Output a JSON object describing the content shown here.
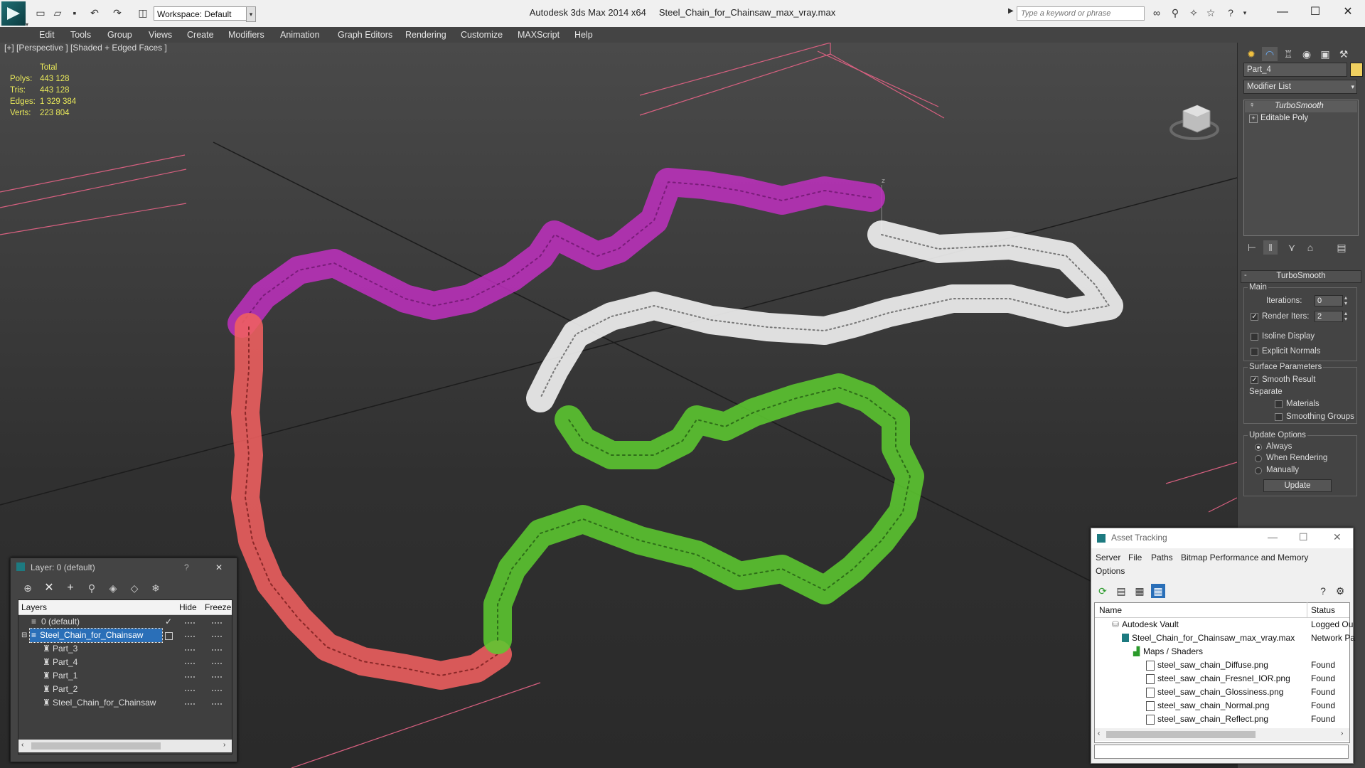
{
  "window": {
    "app_title": "Autodesk 3ds Max  2014 x64",
    "file_title": "Steel_Chain_for_Chainsaw_max_vray.max",
    "workspace_label": "Workspace: Default",
    "search_placeholder": "Type a keyword or phrase",
    "minimize": "—",
    "maximize": "☐",
    "close": "✕"
  },
  "menu": [
    "Edit",
    "Tools",
    "Group",
    "Views",
    "Create",
    "Modifiers",
    "Animation",
    "Graph Editors",
    "Rendering",
    "Customize",
    "MAXScript",
    "Help"
  ],
  "viewport": {
    "label": "[+] [Perspective ] [Shaded + Edged Faces ]",
    "stats": {
      "header": "Total",
      "rows": [
        {
          "label": "Polys:",
          "value": "443 128"
        },
        {
          "label": "Tris:",
          "value": "443 128"
        },
        {
          "label": "Edges:",
          "value": "1 329 384"
        },
        {
          "label": "Verts:",
          "value": "223 804"
        }
      ]
    },
    "gizmo_z": "z",
    "colors": {
      "magenta": "#c030c0",
      "white": "#f2f2f2",
      "red": "#f06060",
      "green": "#5cc830",
      "grid_red": "#d86080"
    }
  },
  "command_panel": {
    "object_name": "Part_4",
    "object_color": "#f0d060",
    "modifier_list": "Modifier List",
    "stack": [
      {
        "label": "TurboSmooth",
        "icon": "bulb-icon"
      },
      {
        "label": "Editable Poly",
        "icon": "plus-box-icon"
      }
    ],
    "rollout": {
      "title": "TurboSmooth",
      "main_label": "Main",
      "iterations_label": "Iterations:",
      "iterations_value": "0",
      "render_iters_label": "Render Iters:",
      "render_iters_value": "2",
      "isoline": "Isoline Display",
      "explicit": "Explicit Normals",
      "surface_label": "Surface Parameters",
      "smooth_result": "Smooth Result",
      "separate_label": "Separate",
      "materials": "Materials",
      "smoothing_groups": "Smoothing Groups",
      "update_options_label": "Update Options",
      "always": "Always",
      "when_rendering": "When Rendering",
      "manually": "Manually",
      "update_button": "Update"
    }
  },
  "layer_panel": {
    "title": "Layer: 0 (default)",
    "help": "?",
    "close": "✕",
    "columns": {
      "layers": "Layers",
      "hide": "Hide",
      "freeze": "Freeze"
    },
    "rows": [
      {
        "name": "0 (default)",
        "indent": 1,
        "selected": false
      },
      {
        "name": "Steel_Chain_for_Chainsaw",
        "indent": 1,
        "selected": true
      },
      {
        "name": "Part_3",
        "indent": 2,
        "selected": false
      },
      {
        "name": "Part_4",
        "indent": 2,
        "selected": false
      },
      {
        "name": "Part_1",
        "indent": 2,
        "selected": false
      },
      {
        "name": "Part_2",
        "indent": 2,
        "selected": false
      },
      {
        "name": "Steel_Chain_for_Chainsaw",
        "indent": 2,
        "selected": false
      }
    ]
  },
  "asset_panel": {
    "title": "Asset Tracking",
    "menu": [
      "Server",
      "File",
      "Paths",
      "Bitmap Performance and Memory",
      "Options"
    ],
    "columns": {
      "name": "Name",
      "status": "Status"
    },
    "rows": [
      {
        "name": "Autodesk Vault",
        "status": "Logged Ou"
      },
      {
        "name": "Steel_Chain_for_Chainsaw_max_vray.max",
        "status": "Network Pa"
      },
      {
        "name": "Maps / Shaders",
        "status": ""
      },
      {
        "name": "steel_saw_chain_Diffuse.png",
        "status": "Found"
      },
      {
        "name": "steel_saw_chain_Fresnel_IOR.png",
        "status": "Found"
      },
      {
        "name": "steel_saw_chain_Glossiness.png",
        "status": "Found"
      },
      {
        "name": "steel_saw_chain_Normal.png",
        "status": "Found"
      },
      {
        "name": "steel_saw_chain_Reflect.png",
        "status": "Found"
      }
    ]
  }
}
